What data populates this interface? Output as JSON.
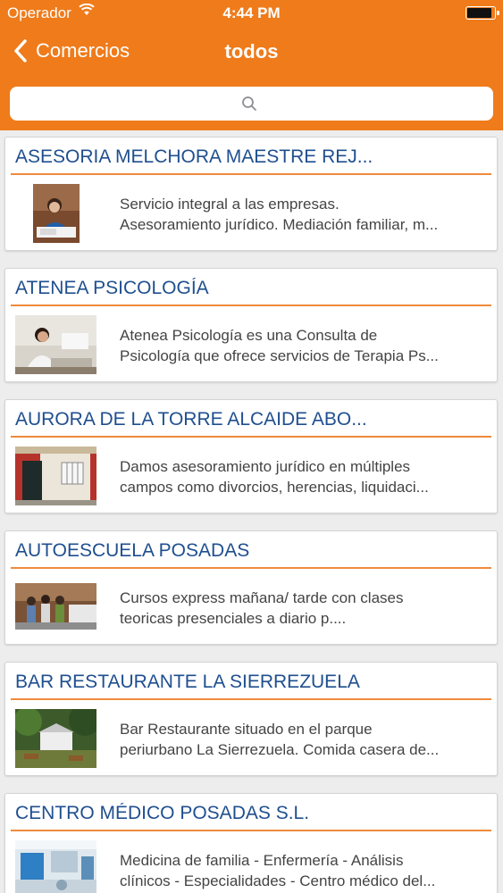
{
  "status_bar": {
    "carrier": "Operador",
    "time": "4:44 PM"
  },
  "nav": {
    "back_label": "Comercios",
    "title": "todos"
  },
  "search": {
    "placeholder": ""
  },
  "businesses": [
    {
      "name": "ASESORIA MELCHORA MAESTRE REJ...",
      "line1": "Servicio integral a las empresas.",
      "line2": "Asesoramiento jurídico. Mediación familiar, m..."
    },
    {
      "name": "ATENEA PSICOLOGÍA",
      "line1": "Atenea Psicología es una Consulta de",
      "line2": "Psicología que ofrece servicios de Terapia Ps..."
    },
    {
      "name": "AURORA DE LA TORRE ALCAIDE ABO...",
      "line1": "Damos asesoramiento jurídico en múltiples",
      "line2": "campos como divorcios,  herencias, liquidaci..."
    },
    {
      "name": "AUTOESCUELA POSADAS",
      "line1": "Cursos express mañana/ tarde con clases",
      "line2": "teoricas presenciales  a diario p...."
    },
    {
      "name": "BAR RESTAURANTE LA SIERREZUELA",
      "line1": "Bar Restaurante situado en el parque",
      "line2": "periurbano La Sierrezuela. Comida casera de..."
    },
    {
      "name": "CENTRO MÉDICO POSADAS S.L.",
      "line1": "Medicina de familia - Enfermería - Análisis",
      "line2": "clínicos - Especialidades - Centro médico del..."
    }
  ],
  "colors": {
    "accent": "#ef7b1b",
    "title_text": "#1f4f8f",
    "divider": "#ef8a3c"
  }
}
